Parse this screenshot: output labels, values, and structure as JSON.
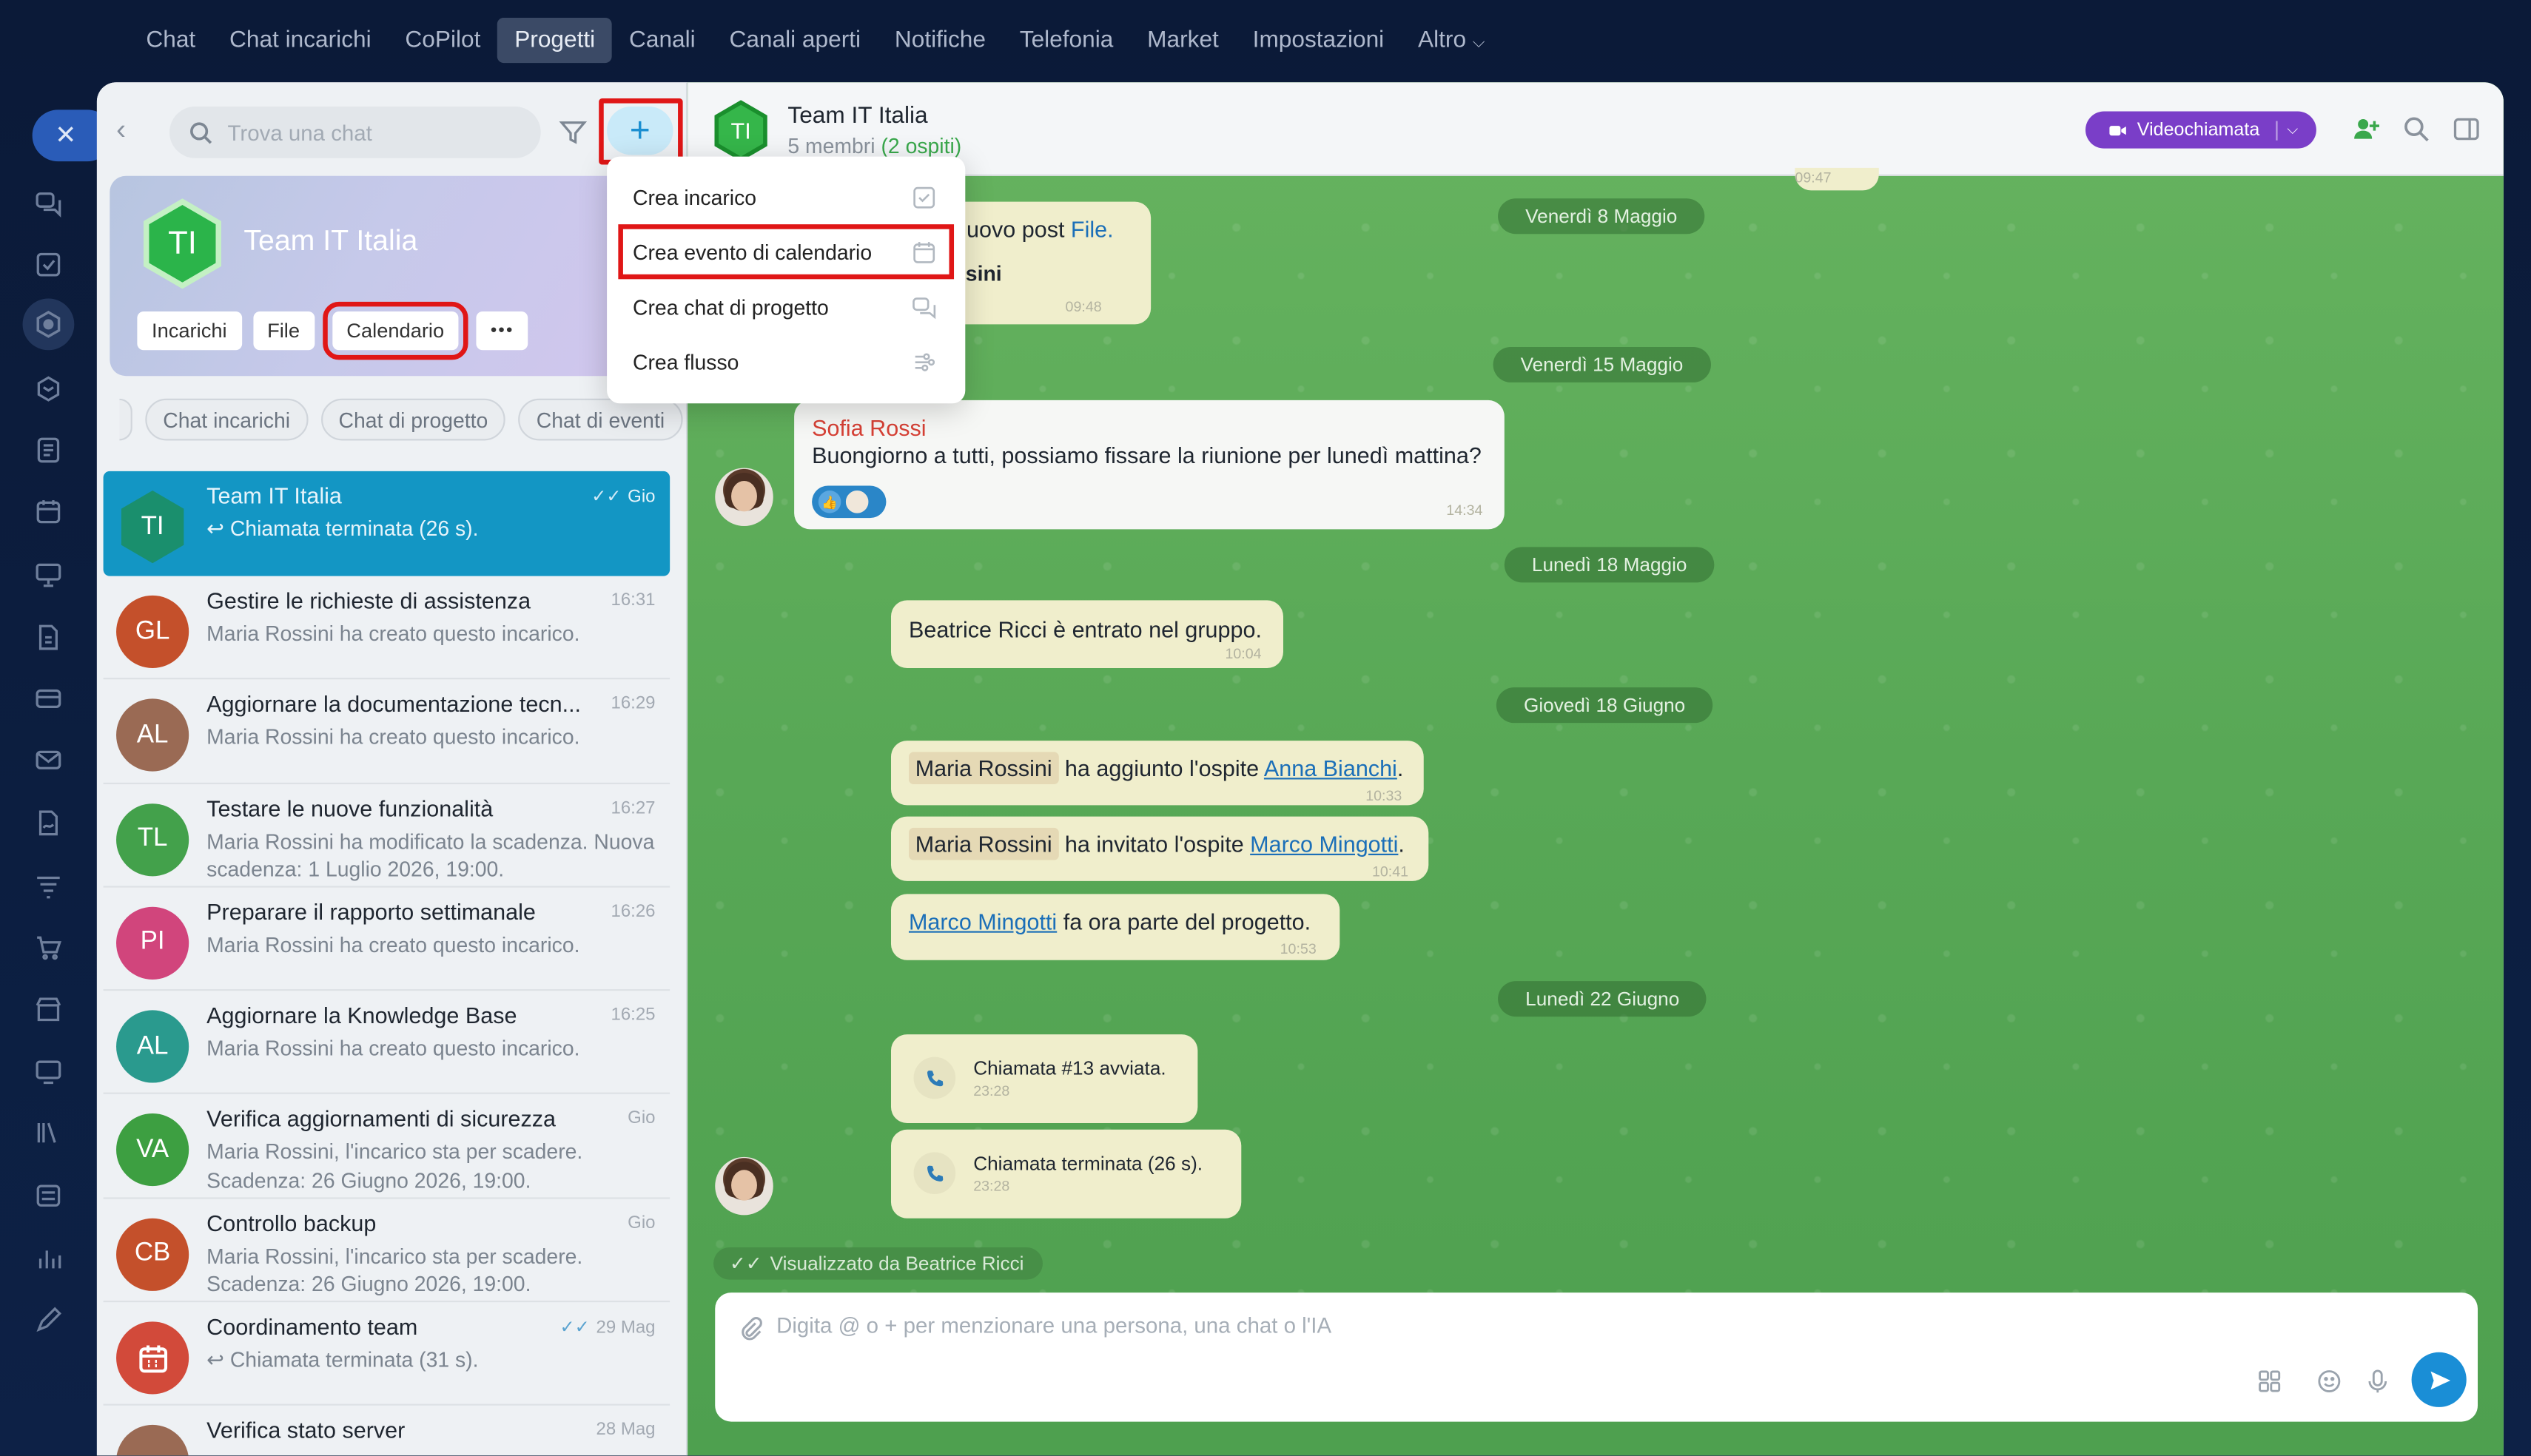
{
  "topnav": {
    "items": [
      "Chat",
      "Chat incarichi",
      "CoPilot",
      "Progetti",
      "Canali",
      "Canali aperti",
      "Notifiche",
      "Telefonia",
      "Market",
      "Impostazioni",
      "Altro"
    ],
    "active": "Progetti"
  },
  "search": {
    "placeholder": "Trova una chat"
  },
  "project": {
    "initials": "TI",
    "title": "Team IT Italia",
    "buttons": [
      "Incarichi",
      "File",
      "Calendario"
    ],
    "more_label": "•••"
  },
  "chips": [
    "Chat incarichi",
    "Chat di progetto",
    "Chat di eventi"
  ],
  "chats": [
    {
      "initials": "TI",
      "name": "Team IT Italia",
      "time": "Gio",
      "msg": "↩ Chiamata terminata (26 s).",
      "color": "#1a8f6d",
      "ticks": "✓✓"
    },
    {
      "initials": "GL",
      "name": "Gestire le richieste di assistenza",
      "time": "16:31",
      "msg": "Maria Rossini ha creato questo incarico.",
      "color": "#c4502b"
    },
    {
      "initials": "AL",
      "name": "Aggiornare la documentazione tecn...",
      "time": "16:29",
      "msg": "Maria Rossini ha creato questo incarico.",
      "color": "#9a6a54"
    },
    {
      "initials": "TL",
      "name": "Testare le nuove funzionalità",
      "time": "16:27",
      "msg": "Maria Rossini ha modificato la scadenza. Nuova scadenza: 1 Luglio 2026, 19:00.",
      "color": "#43a14b"
    },
    {
      "initials": "PI",
      "name": "Preparare il rapporto settimanale",
      "time": "16:26",
      "msg": "Maria Rossini ha creato questo incarico.",
      "color": "#d1457c"
    },
    {
      "initials": "AL",
      "name": "Aggiornare la Knowledge Base",
      "time": "16:25",
      "msg": "Maria Rossini ha creato questo incarico.",
      "color": "#2a9a8e"
    },
    {
      "initials": "VA",
      "name": "Verifica aggiornamenti di sicurezza",
      "time": "Gio",
      "msg": "Maria Rossini, l'incarico sta per scadere. Scadenza: 26 Giugno 2026, 19:00.",
      "color": "#3d9f41"
    },
    {
      "initials": "CB",
      "name": "Controllo backup",
      "time": "Gio",
      "msg": "Maria Rossini, l'incarico sta per scadere. Scadenza: 26 Giugno 2026, 19:00.",
      "color": "#c4502b"
    },
    {
      "initials": "",
      "name": "Coordinamento team",
      "time": "29 Mag",
      "msg": "↩ Chiamata terminata (31 s).",
      "color": "#d24a3a",
      "ticks": "✓✓",
      "calendar": true
    },
    {
      "initials": "",
      "name": "Verifica stato server",
      "time": "28 Mag",
      "msg": "",
      "color": "#9a6a54"
    }
  ],
  "menu": {
    "items": [
      {
        "label": "Crea incarico",
        "icon": "checkbox-icon"
      },
      {
        "label": "Crea evento di calendario",
        "icon": "calendar-icon"
      },
      {
        "label": "Crea chat di progetto",
        "icon": "chat-bubbles-icon"
      },
      {
        "label": "Crea flusso",
        "icon": "flow-icon"
      }
    ]
  },
  "header": {
    "title": "Team IT Italia",
    "members": "5 membri",
    "guests": "(2 ospiti)",
    "video_label": "Videochiamata"
  },
  "messages": {
    "top_time": "09:47",
    "post_text": "nuovo post ",
    "post_link": "File.",
    "post_author": "ssini",
    "post_time": "09:48",
    "dates": [
      "Venerdì 8 Maggio",
      "Venerdì 15 Maggio",
      "Lunedì 18 Maggio",
      "Giovedì 18 Giugno",
      "Lunedì 22 Giugno"
    ],
    "sofia_name": "Sofia Rossi",
    "sofia_text": "Buongiorno a tutti, possiamo fissare la riunione per lunedì mattina?",
    "sofia_time": "14:34",
    "joined_text": "Beatrice Ricci è entrato nel gruppo.",
    "joined_time": "10:04",
    "guest1_who": "Maria Rossini",
    "guest1_action": " ha aggiunto l'ospite ",
    "guest1_link": "Anna Bianchi",
    "guest1_time": "10:33",
    "guest2_who": "Maria Rossini",
    "guest2_action": " ha invitato l'ospite ",
    "guest2_link": "Marco Mingotti",
    "guest2_time": "10:41",
    "part_link": "Marco Mingotti",
    "part_text": " fa ora parte del progetto.",
    "part_time": "10:53",
    "call1_text": "Chiamata #13 avviata.",
    "call1_time": "23:28",
    "call2_text": "Chiamata terminata (26 s).",
    "call2_time": "23:28",
    "seen_by": "Visualizzato da Beatrice Ricci"
  },
  "composer": {
    "placeholder": "Digita @ o + per menzionare una persona, una chat o l'IA"
  }
}
